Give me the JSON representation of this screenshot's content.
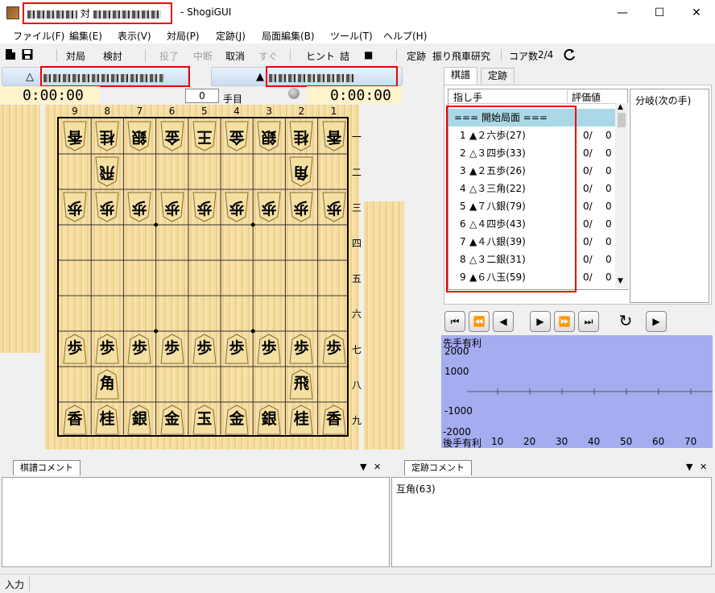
{
  "window": {
    "title_mid": "対",
    "title_suffix": "- ShogiGUI",
    "minimize": "—",
    "maximize": "☐",
    "close": "✕"
  },
  "menu": [
    "ファイル(F)",
    "編集(E)",
    "表示(V)",
    "対局(P)",
    "定跡(J)",
    "局面編集(B)",
    "ツール(T)",
    "ヘルプ(H)"
  ],
  "toolbar": {
    "taikyoku": "対局",
    "kento": "検討",
    "touryou": "投了",
    "chudan": "中断",
    "torikeshi": "取消",
    "sugu": "すぐ",
    "hint": "ヒント",
    "tsume": "詰",
    "stop": "■",
    "joseki": "定跡",
    "joseki_name": "振り飛車研究",
    "core_label": "コア数",
    "core_value": "2/4"
  },
  "players": {
    "gote_mark": "△",
    "sente_mark": "▲"
  },
  "clock": {
    "gote_time": "0:00:00",
    "sente_time": "0:00:00",
    "move_number": "0",
    "move_label": "手目"
  },
  "board": {
    "col_labels": [
      "9",
      "8",
      "7",
      "6",
      "5",
      "4",
      "3",
      "2",
      "1"
    ],
    "row_labels": [
      "一",
      "二",
      "三",
      "四",
      "五",
      "六",
      "七",
      "八",
      "九"
    ]
  },
  "kifu_tabs": [
    "棋譜",
    "定跡"
  ],
  "kifu": {
    "col_move": "指し手",
    "col_eval": "評価値",
    "col_branch": "分岐(次の手)",
    "start": "=== 開始局面 ===",
    "moves": [
      {
        "n": "1",
        "m": "▲２六歩(27)",
        "e": "0/",
        "v": "0"
      },
      {
        "n": "2",
        "m": "△３四歩(33)",
        "e": "0/",
        "v": "0"
      },
      {
        "n": "3",
        "m": "▲２五歩(26)",
        "e": "0/",
        "v": "0"
      },
      {
        "n": "4",
        "m": "△３三角(22)",
        "e": "0/",
        "v": "0"
      },
      {
        "n": "5",
        "m": "▲７八銀(79)",
        "e": "0/",
        "v": "0"
      },
      {
        "n": "6",
        "m": "△４四歩(43)",
        "e": "0/",
        "v": "0"
      },
      {
        "n": "7",
        "m": "▲４八銀(39)",
        "e": "0/",
        "v": "0"
      },
      {
        "n": "8",
        "m": "△３二銀(31)",
        "e": "0/",
        "v": "0"
      },
      {
        "n": "9",
        "m": "▲６八玉(59)",
        "e": "0/",
        "v": "0"
      }
    ]
  },
  "graph": {
    "top_label": "先手有利",
    "bottom_label": "後手有利",
    "y_ticks": [
      "2000",
      "1000",
      "-1000",
      "-2000"
    ],
    "x_ticks": [
      "10",
      "20",
      "30",
      "40",
      "50",
      "60",
      "70"
    ]
  },
  "panes": {
    "kifu_comment": "棋譜コメント",
    "joseki_comment": "定跡コメント",
    "joseki_text": "互角(63)",
    "pin": "▼",
    "close": "✕"
  },
  "status": {
    "input": "入力"
  }
}
